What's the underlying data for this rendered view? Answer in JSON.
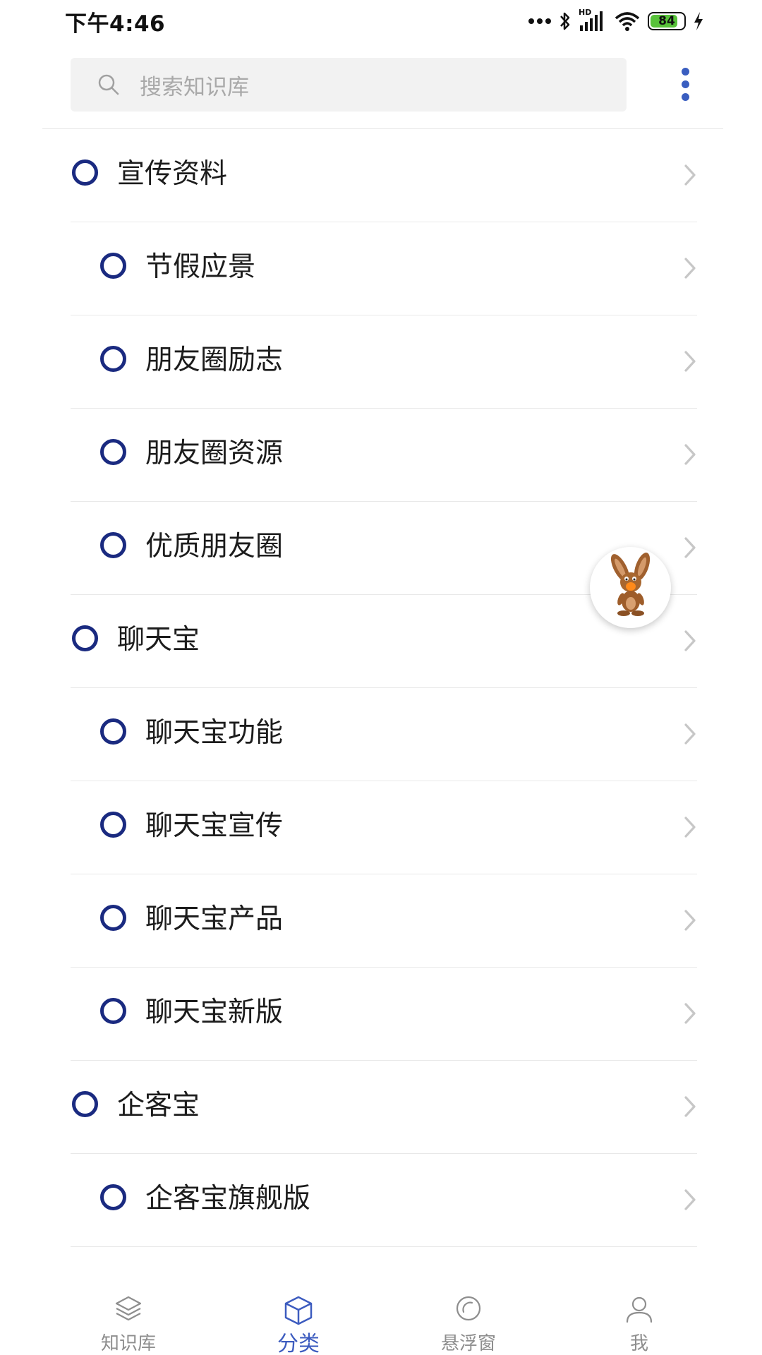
{
  "status_bar": {
    "time": "下午4:46",
    "signal_label": "HD",
    "battery": "84",
    "battery_level": 0.84,
    "battery_color": "#58c23a"
  },
  "header": {
    "search_placeholder": "搜索知识库",
    "more_icon": "more-vertical-icon"
  },
  "colors": {
    "accent": "#3d5cbf",
    "circle": "#1a2a80",
    "text": "#1c1c1c",
    "chevron": "#c7c7c7",
    "divider": "#e8e8e8"
  },
  "list": [
    {
      "label": "宣传资料",
      "level": 0
    },
    {
      "label": "节假应景",
      "level": 1
    },
    {
      "label": "朋友圈励志",
      "level": 1
    },
    {
      "label": "朋友圈资源",
      "level": 1
    },
    {
      "label": "优质朋友圈",
      "level": 1
    },
    {
      "label": "聊天宝",
      "level": 0
    },
    {
      "label": "聊天宝功能",
      "level": 1
    },
    {
      "label": "聊天宝宣传",
      "level": 1
    },
    {
      "label": "聊天宝产品",
      "level": 1
    },
    {
      "label": "聊天宝新版",
      "level": 1
    },
    {
      "label": "企客宝",
      "level": 0
    },
    {
      "label": "企客宝旗舰版",
      "level": 1
    },
    {
      "label": "",
      "level": 1
    }
  ],
  "floating_widget": {
    "icon": "rabbit-mascot-icon"
  },
  "bottom_nav": [
    {
      "label": "知识库",
      "icon": "layers-icon",
      "active": false
    },
    {
      "label": "分类",
      "icon": "cube-icon",
      "active": true
    },
    {
      "label": "悬浮窗",
      "icon": "float-ball-icon",
      "active": false
    },
    {
      "label": "我",
      "icon": "user-icon",
      "active": false
    }
  ]
}
